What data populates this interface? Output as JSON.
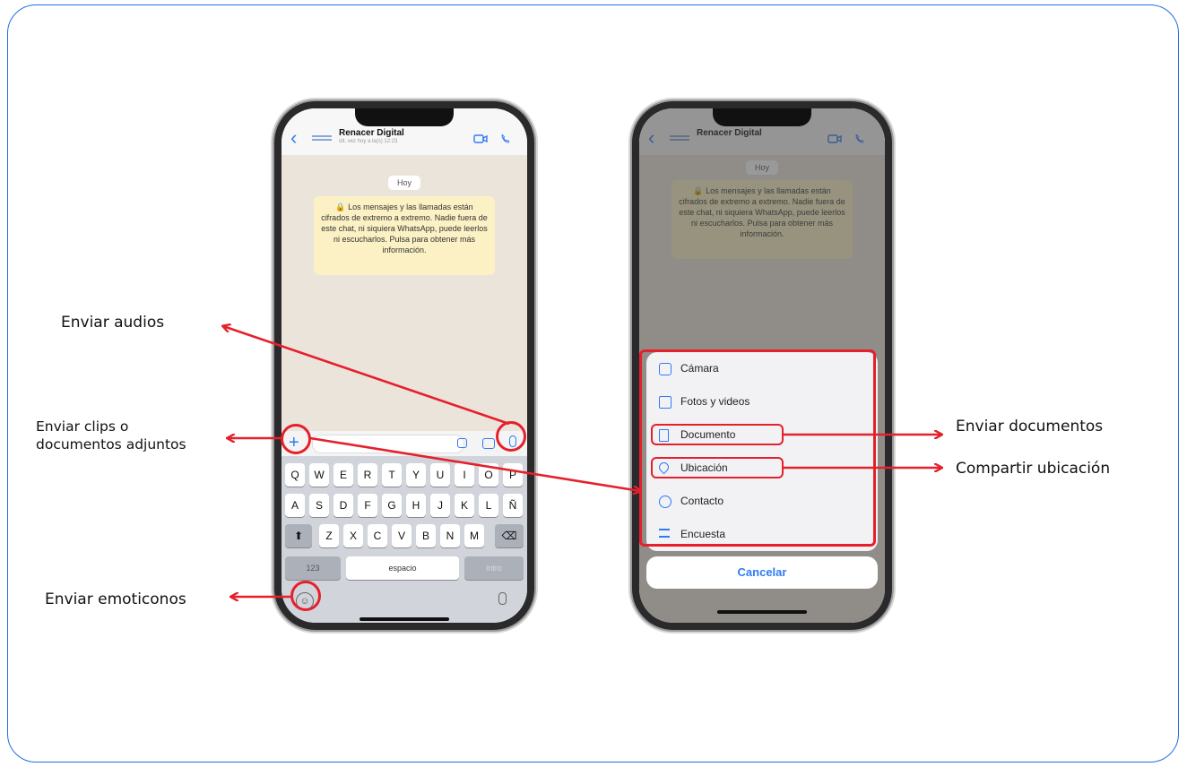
{
  "annotations": {
    "audios": "Enviar audios",
    "clips_line1": "Enviar clips o",
    "clips_line2": "documentos adjuntos",
    "emoticonos": "Enviar emoticonos",
    "documentos": "Enviar documentos",
    "ubicacion": "Compartir ubicación"
  },
  "chat": {
    "contact_name": "Renacer Digital",
    "contact_status": "últ. vez hoy a la(s) 12:23",
    "date_badge": "Hoy",
    "encryption_notice": "Los mensajes y las llamadas están cifrados de extremo a extremo. Nadie fuera de este chat, ni siquiera WhatsApp, puede leerlos ni escucharlos. Pulsa para obtener más información."
  },
  "keyboard": {
    "row1": [
      "Q",
      "W",
      "E",
      "R",
      "T",
      "Y",
      "U",
      "I",
      "O",
      "P"
    ],
    "row2": [
      "A",
      "S",
      "D",
      "F",
      "G",
      "H",
      "J",
      "K",
      "L",
      "Ñ"
    ],
    "row3": [
      "Z",
      "X",
      "C",
      "V",
      "B",
      "N",
      "M"
    ],
    "numbers_key": "123",
    "space_key": "espacio",
    "return_key": "intro"
  },
  "attach_menu": {
    "items": [
      {
        "label": "Cámara",
        "icon": "camera-icon"
      },
      {
        "label": "Fotos y videos",
        "icon": "photo-icon"
      },
      {
        "label": "Documento",
        "icon": "document-icon"
      },
      {
        "label": "Ubicación",
        "icon": "location-icon"
      },
      {
        "label": "Contacto",
        "icon": "contact-icon"
      },
      {
        "label": "Encuesta",
        "icon": "poll-icon"
      }
    ],
    "cancel": "Cancelar"
  },
  "colors": {
    "accent": "#2f7bf5",
    "highlight": "#e5202b",
    "frame": "#1f6fe0"
  }
}
